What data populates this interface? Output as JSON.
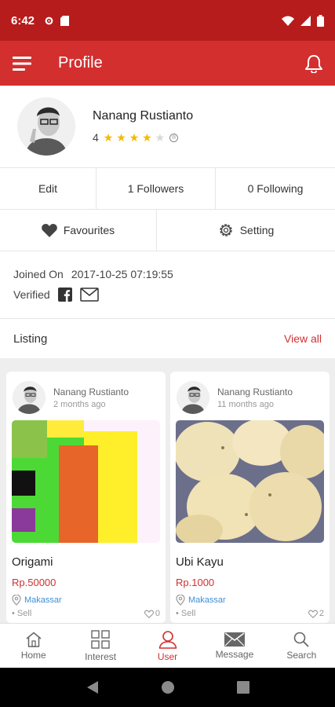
{
  "status_bar": {
    "time": "6:42"
  },
  "app_bar": {
    "title": "Profile"
  },
  "profile": {
    "name": "Nanang Rustianto",
    "rating_value": "4",
    "stars_filled": 4,
    "stars_total": 5
  },
  "stats": {
    "edit": "Edit",
    "followers": "1 Followers",
    "following": "0 Following"
  },
  "actions": {
    "favourites": "Favourites",
    "setting": "Setting"
  },
  "meta": {
    "joined_label": "Joined On",
    "joined_value": "2017-10-25 07:19:55",
    "verified_label": "Verified"
  },
  "listing": {
    "label": "Listing",
    "view_all": "View all",
    "items": [
      {
        "user": "Nanang Rustianto",
        "time": "2 months ago",
        "title": "Origami",
        "price": "Rp.50000",
        "location": "Makassar",
        "type": "Sell",
        "likes": "0"
      },
      {
        "user": "Nanang Rustianto",
        "time": "11 months ago",
        "title": "Ubi Kayu",
        "price": "Rp.1000",
        "location": "Makassar",
        "type": "Sell",
        "likes": "2"
      }
    ]
  },
  "bottom_nav": {
    "items": [
      {
        "label": "Home",
        "icon": "home-icon"
      },
      {
        "label": "Interest",
        "icon": "grid-icon"
      },
      {
        "label": "User",
        "icon": "user-icon"
      },
      {
        "label": "Message",
        "icon": "mail-icon"
      },
      {
        "label": "Search",
        "icon": "search-icon"
      }
    ],
    "active_index": 2
  },
  "colors": {
    "primary": "#d32f2f",
    "status_bar": "#b71c1c",
    "star": "#f5b800",
    "location": "#3f8fd6"
  }
}
